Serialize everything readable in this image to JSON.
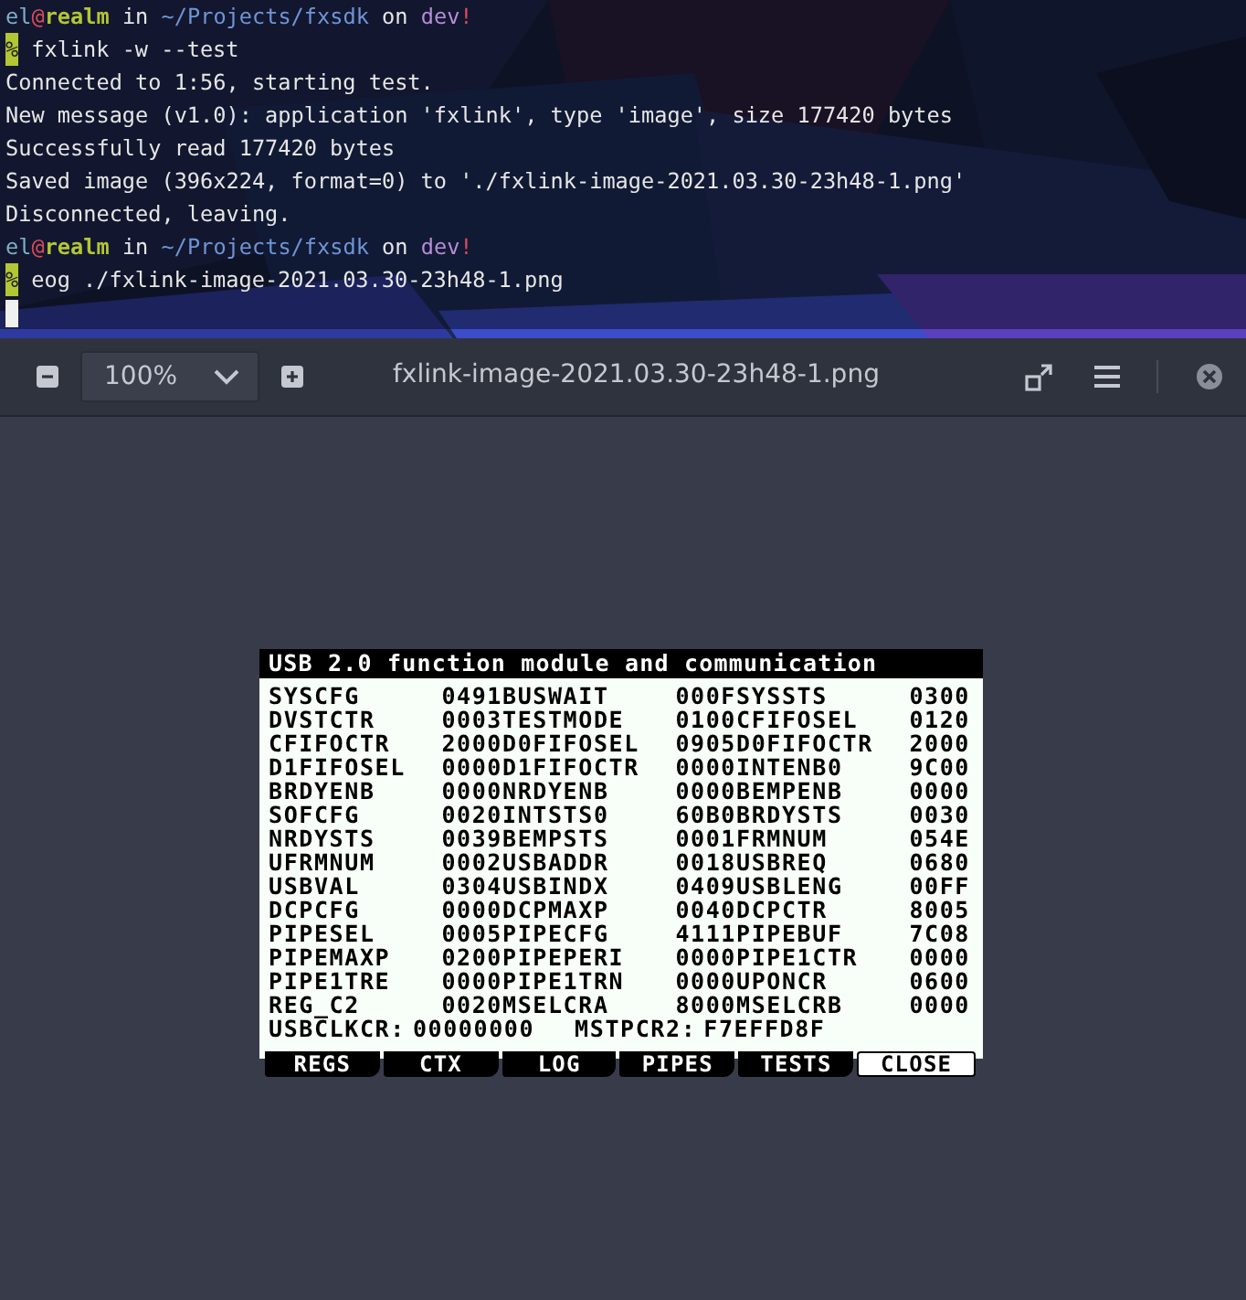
{
  "terminal": {
    "lines": [
      {
        "kind": "prompt",
        "user": "el",
        "at": "@",
        "host": "realm",
        "in": "in",
        "path": "~/Projects/fxsdk",
        "on": "on",
        "branch": "dev",
        "mark": "!"
      },
      {
        "kind": "command",
        "sigil": "%",
        "text": "fxlink -w --test"
      },
      {
        "kind": "output",
        "text": "Connected to 1:56, starting test."
      },
      {
        "kind": "output",
        "text": "New message (v1.0): application 'fxlink', type 'image', size 177420 bytes"
      },
      {
        "kind": "output",
        "text": "Successfully read 177420 bytes"
      },
      {
        "kind": "output",
        "text": "Saved image (396x224, format=0) to './fxlink-image-2021.03.30-23h48-1.png'"
      },
      {
        "kind": "output",
        "text": "Disconnected, leaving."
      },
      {
        "kind": "prompt",
        "user": "el",
        "at": "@",
        "host": "realm",
        "in": "in",
        "path": "~/Projects/fxsdk",
        "on": "on",
        "branch": "dev",
        "mark": "!"
      },
      {
        "kind": "command",
        "sigil": "%",
        "text": "eog ./fxlink-image-2021.03.30-23h48-1.png"
      },
      {
        "kind": "cursor"
      }
    ]
  },
  "viewer": {
    "zoom": "100%",
    "title": "fxlink-image-2021.03.30-23h48-1.png",
    "screen": {
      "title": "USB 2.0 function module and communication",
      "registers": [
        {
          "name": "SYSCFG",
          "value": "0491"
        },
        {
          "name": "BUSWAIT",
          "value": "000F"
        },
        {
          "name": "SYSSTS",
          "value": "0300"
        },
        {
          "name": "DVSTCTR",
          "value": "0003"
        },
        {
          "name": "TESTMODE",
          "value": "0100"
        },
        {
          "name": "CFIFOSEL",
          "value": "0120"
        },
        {
          "name": "CFIFOCTR",
          "value": "2000"
        },
        {
          "name": "D0FIFOSEL",
          "value": "0905"
        },
        {
          "name": "D0FIFOCTR",
          "value": "2000"
        },
        {
          "name": "D1FIFOSEL",
          "value": "0000"
        },
        {
          "name": "D1FIFOCTR",
          "value": "0000"
        },
        {
          "name": "INTENB0",
          "value": "9C00"
        },
        {
          "name": "BRDYENB",
          "value": "0000"
        },
        {
          "name": "NRDYENB",
          "value": "0000"
        },
        {
          "name": "BEMPENB",
          "value": "0000"
        },
        {
          "name": "SOFCFG",
          "value": "0020"
        },
        {
          "name": "INTSTS0",
          "value": "60B0"
        },
        {
          "name": "BRDYSTS",
          "value": "0030"
        },
        {
          "name": "NRDYSTS",
          "value": "0039"
        },
        {
          "name": "BEMPSTS",
          "value": "0001"
        },
        {
          "name": "FRMNUM",
          "value": "054E"
        },
        {
          "name": "UFRMNUM",
          "value": "0002"
        },
        {
          "name": "USBADDR",
          "value": "0018"
        },
        {
          "name": "USBREQ",
          "value": "0680"
        },
        {
          "name": "USBVAL",
          "value": "0304"
        },
        {
          "name": "USBINDX",
          "value": "0409"
        },
        {
          "name": "USBLENG",
          "value": "00FF"
        },
        {
          "name": "DCPCFG",
          "value": "0000"
        },
        {
          "name": "DCPMAXP",
          "value": "0040"
        },
        {
          "name": "DCPCTR",
          "value": "8005"
        },
        {
          "name": "PIPESEL",
          "value": "0005"
        },
        {
          "name": "PIPECFG",
          "value": "4111"
        },
        {
          "name": "PIPEBUF",
          "value": "7C08"
        },
        {
          "name": "PIPEMAXP",
          "value": "0200"
        },
        {
          "name": "PIPEPERI",
          "value": "0000"
        },
        {
          "name": "PIPE1CTR",
          "value": "0000"
        },
        {
          "name": "PIPE1TRE",
          "value": "0000"
        },
        {
          "name": "PIPE1TRN",
          "value": "0000"
        },
        {
          "name": "UPONCR",
          "value": "0600"
        },
        {
          "name": "REG_C2",
          "value": "0020"
        },
        {
          "name": "MSELCRA",
          "value": "8000"
        },
        {
          "name": "MSELCRB",
          "value": "0000"
        }
      ],
      "extra": [
        {
          "name": "USBCLKCR:",
          "value": "00000000"
        },
        {
          "name": "MSTPCR2:",
          "value": "F7EFFD8F"
        }
      ],
      "keys": [
        {
          "kind": "menu",
          "label": "REGS"
        },
        {
          "kind": "menu",
          "label": "CTX"
        },
        {
          "kind": "menu",
          "label": "LOG"
        },
        {
          "kind": "menu",
          "label": "PIPES"
        },
        {
          "kind": "menu",
          "label": "TESTS"
        },
        {
          "kind": "action",
          "label": "CLOSE"
        }
      ]
    }
  }
}
